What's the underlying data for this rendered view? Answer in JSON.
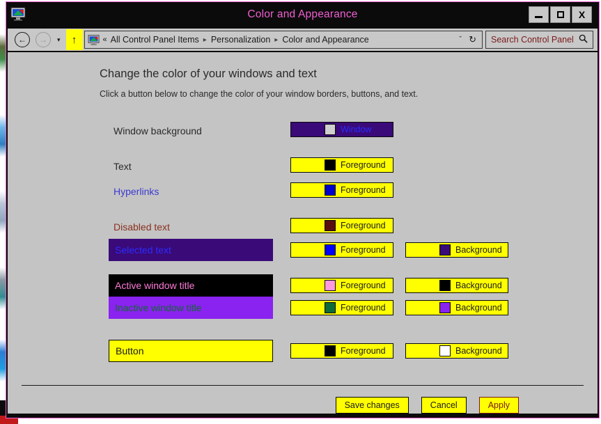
{
  "window": {
    "title": "Color and Appearance",
    "app_icon": "display-monitor-icon",
    "controls": {
      "minimize": "minimize-icon",
      "maximize": "maximize-icon",
      "close": "X"
    }
  },
  "nav": {
    "back": "←",
    "forward": "→",
    "recent_dropdown": "▾",
    "up": "↑",
    "breadcrumb": {
      "overflow": "«",
      "segments": [
        "All Control Panel Items",
        "Personalization",
        "Color and Appearance"
      ],
      "separator": "▸"
    },
    "address_dropdown": "ˇ",
    "refresh": "↻"
  },
  "search": {
    "value": "Search Control Panel",
    "placeholder": "Search Control Panel",
    "icon": "search-icon"
  },
  "page": {
    "heading": "Change the color of your windows and text",
    "subheading": "Click a button below to change the color of your window borders, buttons, and text."
  },
  "colors": {
    "window_bg": "#3a0a78",
    "window_text": "#2b2bff",
    "window_swatch": "#cfcfcf",
    "yellow": "#ffff00",
    "black": "#000000",
    "blue": "#0000cc",
    "dark_red": "#5a0f0f",
    "selected_bg": "#3a0a78",
    "selected_text": "#2b2bff",
    "active_title_bg": "#000000",
    "active_title_text": "#ff7ad9",
    "inactive_title_bg": "#8a22f0",
    "inactive_title_text": "#0e6b2e",
    "button_face": "#ffff00",
    "button_text": "#1a1a1a",
    "hyperlink": "#3a3ad0",
    "disabled_text": "#8a3020",
    "pane_bg": "#c4c4c4"
  },
  "rows": [
    {
      "name": "window-background",
      "label": "Window background",
      "label_style": "plain",
      "label_text_color": "#2a2a2a",
      "label_bg": "",
      "buttons": [
        {
          "kind": "window",
          "name": "window-background-button",
          "label": "Window",
          "swatch": "#cfcfcf",
          "btn_bg": "#3a0a78",
          "btn_text": "#2b2bff"
        }
      ]
    },
    {
      "name": "text",
      "label": "Text",
      "label_style": "plain",
      "label_text_color": "#2a2a2a",
      "label_bg": "",
      "buttons": [
        {
          "kind": "foreground",
          "name": "text-foreground-button",
          "label": "Foreground",
          "swatch": "#000000",
          "btn_bg": "#ffff00",
          "btn_text": "#1a1a1a"
        }
      ]
    },
    {
      "name": "hyperlinks",
      "label": "Hyperlinks",
      "label_style": "plain",
      "label_text_color": "#3a3ad0",
      "label_bg": "",
      "buttons": [
        {
          "kind": "foreground",
          "name": "hyperlinks-foreground-button",
          "label": "Foreground",
          "swatch": "#0000cc",
          "btn_bg": "#ffff00",
          "btn_text": "#1a1a1a"
        }
      ]
    },
    {
      "name": "disabled-text",
      "label": "Disabled text",
      "label_style": "plain",
      "label_text_color": "#8a3020",
      "label_bg": "",
      "buttons": [
        {
          "kind": "foreground",
          "name": "disabled-text-foreground-button",
          "label": "Foreground",
          "swatch": "#5a0f0f",
          "btn_bg": "#ffff00",
          "btn_text": "#1a1a1a"
        }
      ]
    },
    {
      "name": "selected-text",
      "label": "Selected text",
      "label_style": "swatchbox",
      "label_text_color": "#2b2bff",
      "label_bg": "#3a0a78",
      "buttons": [
        {
          "kind": "foreground",
          "name": "selected-text-foreground-button",
          "label": "Foreground",
          "swatch": "#0000ff",
          "btn_bg": "#ffff00",
          "btn_text": "#1a1a1a"
        },
        {
          "kind": "background",
          "name": "selected-text-background-button",
          "label": "Background",
          "swatch": "#3a0a78",
          "btn_bg": "#ffff00",
          "btn_text": "#1a1a1a"
        }
      ]
    },
    {
      "name": "active-window-title",
      "label": "Active window title",
      "label_style": "swatchbox",
      "label_text_color": "#ff7ad9",
      "label_bg": "#000000",
      "buttons": [
        {
          "kind": "foreground",
          "name": "active-window-title-foreground-button",
          "label": "Foreground",
          "swatch": "#ff9ae0",
          "btn_bg": "#ffff00",
          "btn_text": "#1a1a1a"
        },
        {
          "kind": "background",
          "name": "active-window-title-background-button",
          "label": "Background",
          "swatch": "#000000",
          "btn_bg": "#ffff00",
          "btn_text": "#1a1a1a"
        }
      ]
    },
    {
      "name": "inactive-window-title",
      "label": "Inactive window title",
      "label_style": "swatchbox",
      "label_text_color": "#0e6b2e",
      "label_bg": "#8a22f0",
      "buttons": [
        {
          "kind": "foreground",
          "name": "inactive-window-title-foreground-button",
          "label": "Foreground",
          "swatch": "#0e6b3c",
          "btn_bg": "#ffff00",
          "btn_text": "#1a1a1a"
        },
        {
          "kind": "background",
          "name": "inactive-window-title-background-button",
          "label": "Background",
          "swatch": "#8a22f0",
          "btn_bg": "#ffff00",
          "btn_text": "#1a1a1a"
        }
      ]
    },
    {
      "name": "button",
      "label": "Button",
      "label_style": "swatchbox",
      "label_text_color": "#1a1a1a",
      "label_bg": "#ffff00",
      "buttons": [
        {
          "kind": "foreground",
          "name": "button-foreground-button",
          "label": "Foreground",
          "swatch": "#000000",
          "btn_bg": "#ffff00",
          "btn_text": "#1a1a1a"
        },
        {
          "kind": "background",
          "name": "button-background-button",
          "label": "Background",
          "swatch": "#ffffff",
          "btn_bg": "#ffff00",
          "btn_text": "#1a1a1a"
        }
      ]
    }
  ],
  "footer": {
    "save": "Save changes",
    "cancel": "Cancel",
    "apply": "Apply",
    "apply_disabled": true
  }
}
